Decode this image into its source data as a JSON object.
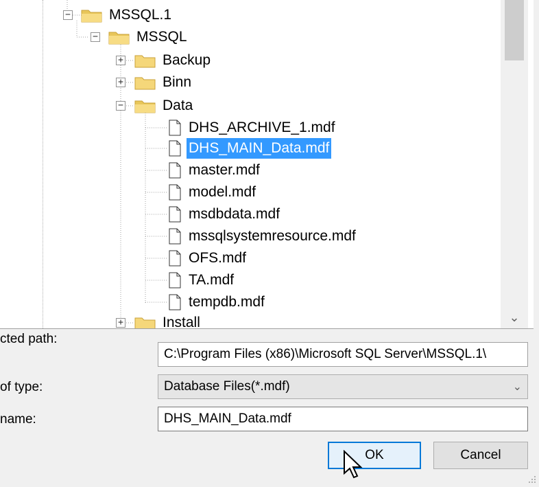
{
  "tree": {
    "nodes": [
      {
        "label": "MSSQL.1",
        "type": "folder",
        "expanded": true
      },
      {
        "label": "MSSQL",
        "type": "folder",
        "expanded": true
      },
      {
        "label": "Backup",
        "type": "folder",
        "expanded": false
      },
      {
        "label": "Binn",
        "type": "folder",
        "expanded": false
      },
      {
        "label": "Data",
        "type": "folder",
        "expanded": true
      },
      {
        "label": "DHS_ARCHIVE_1.mdf",
        "type": "file"
      },
      {
        "label": "DHS_MAIN_Data.mdf",
        "type": "file",
        "selected": true
      },
      {
        "label": "master.mdf",
        "type": "file"
      },
      {
        "label": "model.mdf",
        "type": "file"
      },
      {
        "label": "msdbdata.mdf",
        "type": "file"
      },
      {
        "label": "mssqlsystemresource.mdf",
        "type": "file"
      },
      {
        "label": "OFS.mdf",
        "type": "file"
      },
      {
        "label": "TA.mdf",
        "type": "file"
      },
      {
        "label": "tempdb.mdf",
        "type": "file"
      },
      {
        "label": "Install",
        "type": "folder",
        "expanded": false
      }
    ]
  },
  "form": {
    "selected_path_label": "cted path:",
    "selected_path_value": "C:\\Program Files (x86)\\Microsoft SQL Server\\MSSQL.1\\",
    "files_of_type_label": "of type:",
    "files_of_type_value": "Database Files(*.mdf)",
    "file_name_label": "name:",
    "file_name_value": "DHS_MAIN_Data.mdf"
  },
  "buttons": {
    "ok": "OK",
    "cancel": "Cancel"
  },
  "colors": {
    "selection": "#3399ff",
    "default_button_border": "#0078d7",
    "folder": "#f5d77a"
  }
}
